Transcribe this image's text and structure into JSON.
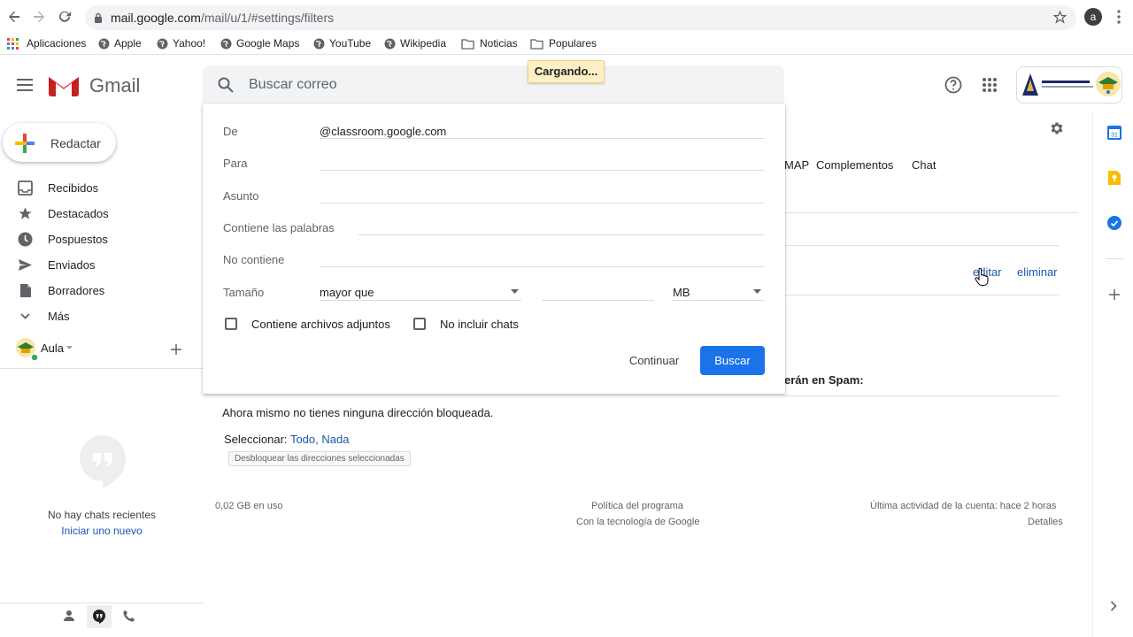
{
  "browser": {
    "url_host": "mail.google.com",
    "url_path": "/mail/u/1/#settings/filters",
    "profile_initial": "a",
    "bookmarks": [
      "Aplicaciones",
      "Apple",
      "Yahoo!",
      "Google Maps",
      "YouTube",
      "Wikipedia",
      "Noticias",
      "Populares"
    ]
  },
  "header": {
    "app_name": "Gmail",
    "search_placeholder": "Buscar correo",
    "loading": "Cargando..."
  },
  "sidebar": {
    "compose": "Redactar",
    "items": [
      {
        "label": "Recibidos",
        "icon": "inbox-icon"
      },
      {
        "label": "Destacados",
        "icon": "star-icon"
      },
      {
        "label": "Pospuestos",
        "icon": "clock-icon"
      },
      {
        "label": "Enviados",
        "icon": "send-icon"
      },
      {
        "label": "Borradores",
        "icon": "draft-icon"
      },
      {
        "label": "Más",
        "icon": "chevron-down-icon"
      }
    ],
    "hangouts_user": "Aula",
    "no_chats": "No hay chats recientes",
    "start_new": "Iniciar uno nuevo"
  },
  "settings_bg": {
    "tab_imap": "MAP",
    "tab_addons": "Complementos",
    "tab_chat": "Chat",
    "edit": "editar",
    "delete": "eliminar",
    "spam_label": "erán en Spam:",
    "no_blocked": "Ahora mismo no tienes ninguna dirección bloqueada.",
    "select_label": "Seleccionar:",
    "select_all": "Todo",
    "select_none": "Nada",
    "unblock_button": "Desbloquear las direcciones seleccionadas"
  },
  "search_panel": {
    "from_label": "De",
    "from_value": "@classroom.google.com",
    "to_label": "Para",
    "subject_label": "Asunto",
    "has_words_label": "Contiene las palabras",
    "not_contains_label": "No contiene",
    "size_label": "Tamaño",
    "size_operator": "mayor que",
    "size_unit": "MB",
    "has_attachment": "Contiene archivos adjuntos",
    "exclude_chats": "No incluir chats",
    "continue": "Continuar",
    "search": "Buscar"
  },
  "footer": {
    "storage": "0,02 GB en uso",
    "policy": "Política del programa",
    "powered": "Con la tecnología de Google",
    "last_activity": "Última actividad de la cuenta: hace 2 horas",
    "details": "Detalles"
  }
}
